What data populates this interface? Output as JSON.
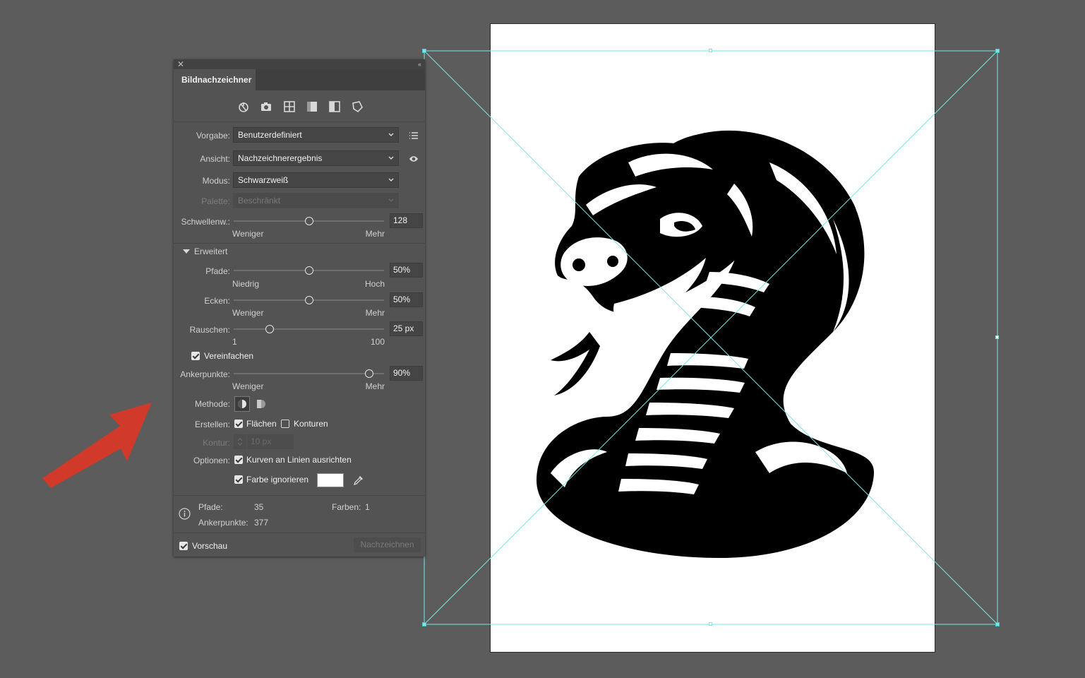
{
  "panel": {
    "title": "Bildnachzeichner",
    "close_glyph": "✕",
    "collapse_glyph": "‹‹",
    "preset_icons": [
      "auto-color-icon",
      "high-color-photo-icon",
      "low-color-icon",
      "grayscale-icon",
      "black-white-icon",
      "outline-icon"
    ],
    "vorgabe": {
      "label": "Vorgabe:",
      "value": "Benutzerdefiniert"
    },
    "ansicht": {
      "label": "Ansicht:",
      "value": "Nachzeichnerergebnis"
    },
    "modus": {
      "label": "Modus:",
      "value": "Schwarzweiß"
    },
    "palette": {
      "label": "Palette:",
      "value": "Beschränkt"
    },
    "schwellenwert": {
      "label": "Schwellenw.:",
      "value": "128",
      "min_label": "Weniger",
      "max_label": "Mehr",
      "level": 0.5
    },
    "erweitert_label": "Erweitert",
    "pfade": {
      "label": "Pfade:",
      "value": "50%",
      "min_label": "Niedrig",
      "max_label": "Hoch",
      "level": 0.5
    },
    "ecken": {
      "label": "Ecken:",
      "value": "50%",
      "min_label": "Weniger",
      "max_label": "Mehr",
      "level": 0.5
    },
    "rauschen": {
      "label": "Rauschen:",
      "value": "25 px",
      "min_label": "1",
      "max_label": "100",
      "level": 0.24
    },
    "vereinfachen_label": "Vereinfachen",
    "ankerpunkte": {
      "label": "Ankerpunkte:",
      "value": "90%",
      "min_label": "Weniger",
      "max_label": "Mehr",
      "level": 0.9
    },
    "methode_label": "Methode:",
    "erstellen": {
      "label": "Erstellen:",
      "flaechen": "Flächen",
      "konturen": "Konturen"
    },
    "kontur": {
      "label": "Kontur:",
      "value": "10 px"
    },
    "optionen": {
      "label": "Optionen:",
      "kurven": "Kurven an Linien ausrichten",
      "farbe": "Farbe ignorieren"
    },
    "info": {
      "pfade_label": "Pfade:",
      "pfade_value": "35",
      "farben_label": "Farben:",
      "farben_value": "1",
      "anker_label": "Ankerpunkte:",
      "anker_value": "377"
    },
    "vorschau_label": "Vorschau",
    "nachzeichnen_label": "Nachzeichnen"
  },
  "colors": {
    "canvas_bg": "#5c5c5c",
    "panel_bg": "#535353",
    "selection": "#7ee3e6",
    "arrow": "#d13a2a"
  }
}
